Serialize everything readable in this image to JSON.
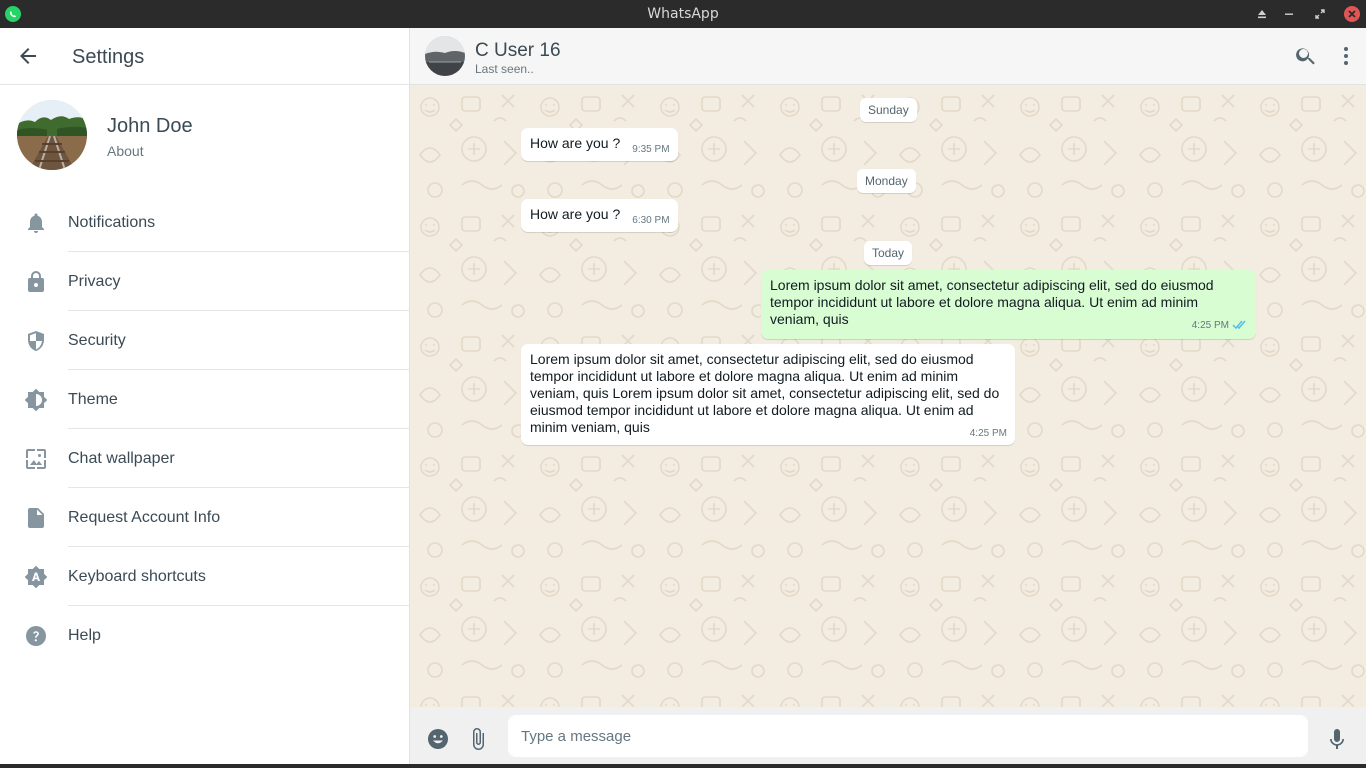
{
  "window": {
    "title": "WhatsApp"
  },
  "settings": {
    "title": "Settings",
    "profile": {
      "name": "John Doe",
      "about": "About"
    },
    "menu": [
      {
        "label": "Notifications",
        "icon": "bell-icon"
      },
      {
        "label": "Privacy",
        "icon": "lock-icon"
      },
      {
        "label": "Security",
        "icon": "shield-icon"
      },
      {
        "label": "Theme",
        "icon": "theme-icon"
      },
      {
        "label": "Chat wallpaper",
        "icon": "wallpaper-icon"
      },
      {
        "label": "Request Account Info",
        "icon": "document-icon"
      },
      {
        "label": "Keyboard shortcuts",
        "icon": "keyboard-icon"
      },
      {
        "label": "Help",
        "icon": "help-icon"
      }
    ]
  },
  "chat": {
    "contact_name": "C User 16",
    "contact_status": "Last seen..",
    "days": [
      {
        "label": "Sunday"
      },
      {
        "label": "Monday"
      },
      {
        "label": "Today"
      }
    ],
    "messages": [
      {
        "direction": "incoming",
        "text": "How are you ?",
        "time": "9:35 PM"
      },
      {
        "direction": "incoming",
        "text": "How are you ?",
        "time": "6:30 PM"
      },
      {
        "direction": "outgoing",
        "text": "Lorem ipsum dolor sit amet, consectetur adipiscing elit, sed do eiusmod tempor incididunt ut labore et dolore magna aliqua. Ut enim ad minim veniam, quis",
        "time": "4:25 PM",
        "status": "read"
      },
      {
        "direction": "incoming",
        "text": "Lorem ipsum dolor sit amet, consectetur adipiscing elit, sed do eiusmod tempor incididunt ut labore et dolore magna aliqua. Ut enim ad minim veniam, quis Lorem ipsum dolor sit amet, consectetur adipiscing elit, sed do eiusmod tempor incididunt ut labore et dolore magna aliqua. Ut enim ad minim veniam, quis",
        "time": "4:25 PM"
      }
    ],
    "composer": {
      "placeholder": "Type a message"
    }
  },
  "colors": {
    "accent": "#25d366",
    "outgoing_bubble": "#d9fdd3",
    "chat_background": "#efeae2",
    "read_ticks": "#53bdeb"
  }
}
